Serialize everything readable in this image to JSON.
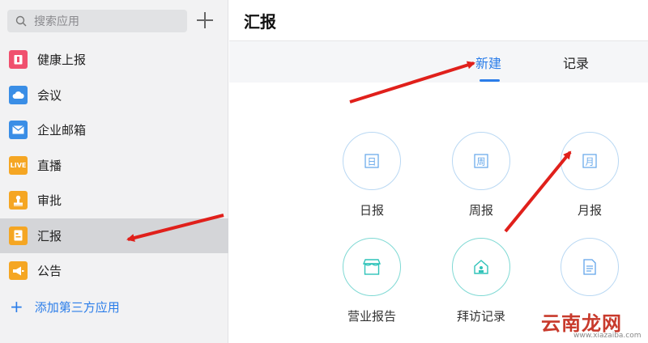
{
  "search": {
    "placeholder": "搜索应用"
  },
  "sidebar": {
    "items": [
      {
        "label": "健康上报",
        "icon": "health-report-icon",
        "color": "#f0506e",
        "glyph": ""
      },
      {
        "label": "会议",
        "icon": "cloud-meeting-icon",
        "color": "#3a8ee6",
        "glyph": ""
      },
      {
        "label": "企业邮箱",
        "icon": "mail-icon",
        "color": "#3a8ee6",
        "glyph": ""
      },
      {
        "label": "直播",
        "icon": "live-icon",
        "color": "#f5a623",
        "glyph": "LIVE"
      },
      {
        "label": "审批",
        "icon": "stamp-icon",
        "color": "#f5a623",
        "glyph": ""
      },
      {
        "label": "汇报",
        "icon": "report-icon",
        "color": "#f5a623",
        "glyph": ""
      },
      {
        "label": "公告",
        "icon": "megaphone-icon",
        "color": "#f5a623",
        "glyph": ""
      }
    ],
    "active_index": 5,
    "add_third_party": "添加第三方应用"
  },
  "main": {
    "title": "汇报",
    "tabs": {
      "new": "新建",
      "records": "记录"
    },
    "tiles": [
      {
        "label": "日报",
        "glyph": "日",
        "style": "blue"
      },
      {
        "label": "周报",
        "glyph": "周",
        "style": "blue"
      },
      {
        "label": "月报",
        "glyph": "月",
        "style": "blue"
      },
      {
        "label": "营业报告",
        "glyph": "",
        "style": "teal"
      },
      {
        "label": "拜访记录",
        "glyph": "",
        "style": "teal"
      },
      {
        "label": "",
        "glyph": "",
        "style": "blue"
      }
    ]
  },
  "watermark": {
    "text": "云南龙网",
    "sub": "www.xiazaiba.com"
  },
  "colors": {
    "accent": "#2b7de9",
    "arrow": "#e0201b"
  }
}
